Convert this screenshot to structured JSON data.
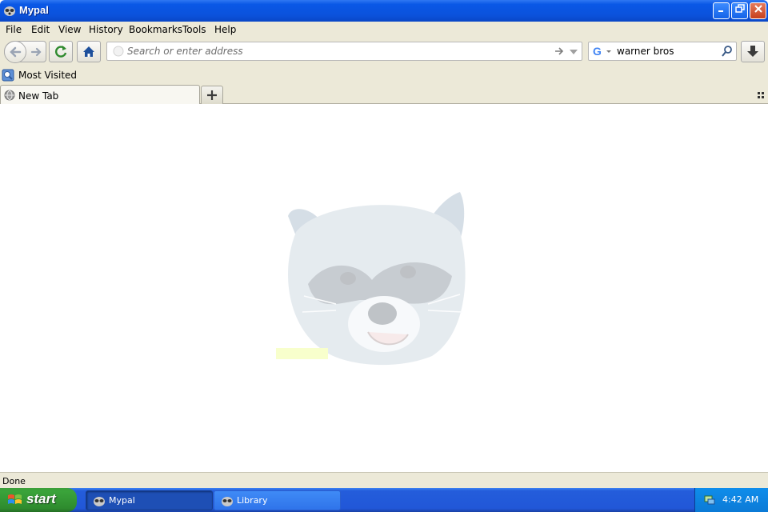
{
  "window": {
    "title": "Mypal",
    "icon": "raccoon-icon",
    "controls": [
      "minimize",
      "restore",
      "close"
    ]
  },
  "menu": {
    "items": [
      "File",
      "Edit",
      "View",
      "History",
      "Bookmarks",
      "Tools",
      "Help"
    ]
  },
  "navbar": {
    "url_placeholder": "Search or enter address",
    "url_value": "",
    "search_engine_icon": "google-icon",
    "search_value": "warner bros"
  },
  "bookmarks": {
    "items": [
      {
        "label": "Most Visited",
        "icon": "most-visited-icon"
      }
    ]
  },
  "tabs": {
    "items": [
      {
        "label": "New Tab",
        "icon": "globe-icon"
      }
    ]
  },
  "content": {
    "logo": "mypal-raccoon-logo"
  },
  "status": {
    "text": "Done"
  },
  "taskbar": {
    "start_label": "start",
    "tasks": [
      {
        "label": "Mypal",
        "icon": "raccoon-icon",
        "active": true
      },
      {
        "label": "Library",
        "icon": "raccoon-icon",
        "active": false
      }
    ],
    "clock": "4:42 AM"
  },
  "colors": {
    "titlebar": "#0b52dc",
    "chrome": "#ece9d8",
    "taskbar": "#2157d8",
    "start": "#3aa33a",
    "tray": "#0f8deb"
  }
}
